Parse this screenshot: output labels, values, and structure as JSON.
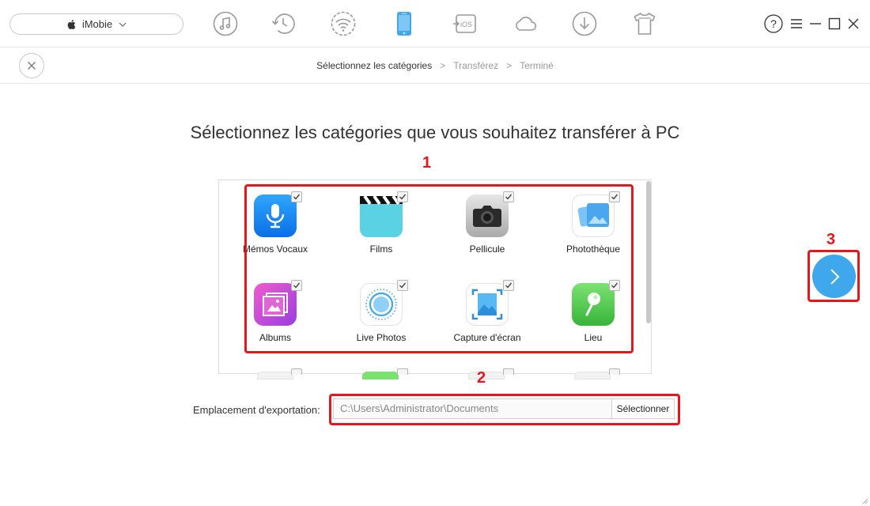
{
  "app": {
    "device_name": "iMobie"
  },
  "toolbar": {
    "tools": [
      {
        "icon": "music-icon"
      },
      {
        "icon": "history-icon"
      },
      {
        "icon": "wifi-icon"
      },
      {
        "icon": "phone-icon",
        "active": true
      },
      {
        "icon": "ios-icon",
        "text": "iOS"
      },
      {
        "icon": "cloud-icon"
      },
      {
        "icon": "download-icon"
      },
      {
        "icon": "tshirt-icon"
      }
    ],
    "help_symbol": "?",
    "active_color": "#3fa7ec",
    "inactive_color": "#9a9a9a"
  },
  "breadcrumb": {
    "step1": "Sélectionnez les catégories",
    "step2": "Transférez",
    "step3": "Terminé",
    "separator": ">"
  },
  "heading": "Sélectionnez les catégories que vous souhaitez transférer à PC",
  "categories": [
    {
      "label": "Mémos Vocaux",
      "icon": "microphone-icon",
      "checked": true
    },
    {
      "label": "Films",
      "icon": "clapperboard-icon",
      "checked": true
    },
    {
      "label": "Pellicule",
      "icon": "camera-icon",
      "checked": true
    },
    {
      "label": "Photothèque",
      "icon": "photo-library-icon",
      "checked": true
    },
    {
      "label": "Albums",
      "icon": "albums-icon",
      "checked": true
    },
    {
      "label": "Live Photos",
      "icon": "live-photos-icon",
      "checked": true
    },
    {
      "label": "Capture d'écran",
      "icon": "screenshot-icon",
      "checked": true
    },
    {
      "label": "Lieu",
      "icon": "location-pin-icon",
      "checked": true
    }
  ],
  "annotations": {
    "one": "1",
    "two": "2",
    "three": "3",
    "color": "#e8151b"
  },
  "export": {
    "label": "Emplacement d'exportation:",
    "path": "C:\\Users\\Administrator\\Documents",
    "button": "Sélectionner"
  }
}
